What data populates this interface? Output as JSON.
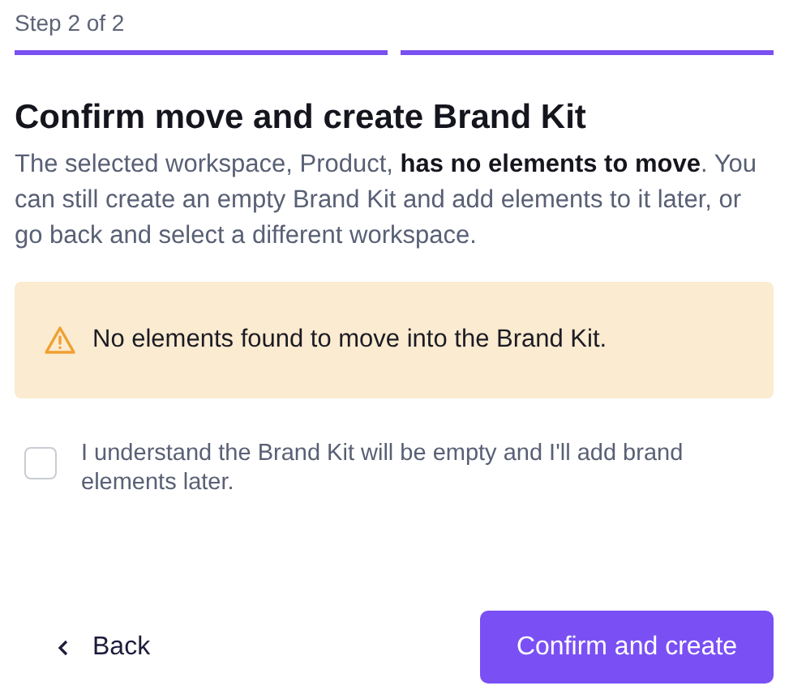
{
  "step_label": "Step 2 of 2",
  "steps": [
    {
      "completed": true
    },
    {
      "completed": true
    }
  ],
  "title": "Confirm move and create Brand Kit",
  "description": "The selected workspace, Product, **has no elements to move**. You can still create an empty Brand Kit and add elements to it later, or go back and select a different workspace.",
  "alert": {
    "text": "No elements found to move into the Brand Kit."
  },
  "confirmation": {
    "label": "I understand the Brand Kit will be empty and I'll add brand elements later.",
    "checked": false
  },
  "buttons": {
    "back": "Back",
    "primary": "Confirm and create"
  }
}
